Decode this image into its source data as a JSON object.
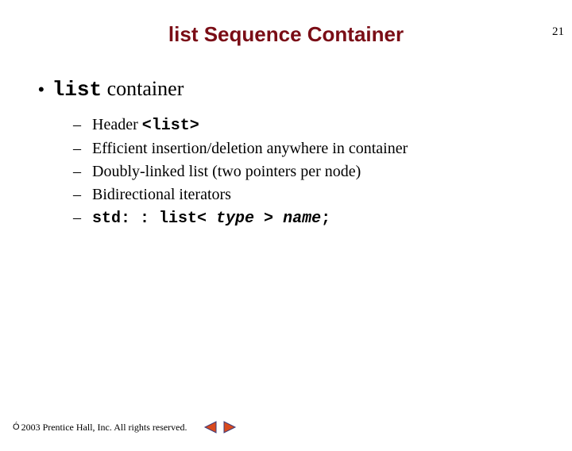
{
  "page_number": "21",
  "title": "list Sequence Container",
  "main": {
    "bullet_dot": "•",
    "code_word": "list",
    "after_code": " container"
  },
  "sub": {
    "dash": "–",
    "items": [
      {
        "prefix": "Header ",
        "code": "<list>",
        "suffix": ""
      },
      {
        "prefix": "Efficient insertion/deletion anywhere in container",
        "code": "",
        "suffix": ""
      },
      {
        "prefix": "Doubly-linked list (two pointers per node)",
        "code": "",
        "suffix": ""
      },
      {
        "prefix": "Bidirectional iterators",
        "code": "",
        "suffix": ""
      }
    ],
    "last": {
      "code_pre": "std: : list< ",
      "type": "type",
      "code_mid": " > ",
      "name": "name",
      "code_post": ";"
    }
  },
  "footer": {
    "sym": "Ó",
    "text": " 2003 Prentice Hall, Inc.  All rights reserved."
  }
}
